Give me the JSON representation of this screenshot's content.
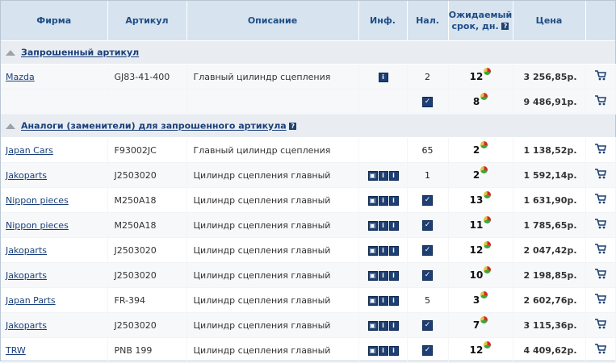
{
  "headers": {
    "firm": "Фирма",
    "article": "Артикул",
    "description": "Описание",
    "info": "Инф.",
    "stock": "Нал.",
    "lead_line1": "Ожидаемый",
    "lead_line2": "срок, дн.",
    "help_glyph": "?",
    "price": "Цена"
  },
  "section_requested": {
    "title": "Запрошенный артикул"
  },
  "section_analogs": {
    "title": "Аналоги (заменители) для запрошенного артикула",
    "help_glyph": "?"
  },
  "requested_rows": [
    {
      "firm": "Mazda",
      "article": "GJ83-41-400",
      "description": "Главный цилиндр сцепления",
      "info_icons": [
        "info-icon"
      ],
      "stock": "2",
      "stock_check": false,
      "lead": "12",
      "price": "3 256,85р."
    },
    {
      "firm": "",
      "article": "",
      "description": "",
      "info_icons": [],
      "stock": "",
      "stock_check": true,
      "lead": "8",
      "price": "9 486,91р."
    }
  ],
  "analog_rows": [
    {
      "firm": "Japan Cars",
      "article": "F93002JC",
      "description": "Главный цилиндр сцепления",
      "info_icons": [],
      "stock": "65",
      "stock_check": false,
      "lead": "2",
      "price": "1 138,52р."
    },
    {
      "firm": "Jakoparts",
      "article": "J2503020",
      "description": "Цилиндр сцепления главный",
      "info_icons": [
        "photo-icon",
        "info-icon",
        "info-icon"
      ],
      "stock": "1",
      "stock_check": false,
      "lead": "2",
      "price": "1 592,14р."
    },
    {
      "firm": "Nippon pieces",
      "article": "M250A18",
      "description": "Цилиндр сцепления главный",
      "info_icons": [
        "photo-icon",
        "info-icon",
        "info-icon"
      ],
      "stock": "",
      "stock_check": true,
      "lead": "13",
      "price": "1 631,90р."
    },
    {
      "firm": "Nippon pieces",
      "article": "M250A18",
      "description": "Цилиндр сцепления главный",
      "info_icons": [
        "photo-icon",
        "info-icon",
        "info-icon"
      ],
      "stock": "",
      "stock_check": true,
      "lead": "11",
      "price": "1 785,65р."
    },
    {
      "firm": "Jakoparts",
      "article": "J2503020",
      "description": "Цилиндр сцепления главный",
      "info_icons": [
        "photo-icon",
        "info-icon",
        "info-icon"
      ],
      "stock": "",
      "stock_check": true,
      "lead": "12",
      "price": "2 047,42р."
    },
    {
      "firm": "Jakoparts",
      "article": "J2503020",
      "description": "Цилиндр сцепления главный",
      "info_icons": [
        "photo-icon",
        "info-icon",
        "info-icon"
      ],
      "stock": "",
      "stock_check": true,
      "lead": "10",
      "price": "2 198,85р."
    },
    {
      "firm": "Japan Parts",
      "article": "FR-394",
      "description": "Цилиндр сцепления главный",
      "info_icons": [
        "photo-icon",
        "info-icon",
        "info-icon"
      ],
      "stock": "5",
      "stock_check": false,
      "lead": "3",
      "price": "2 602,76р."
    },
    {
      "firm": "Jakoparts",
      "article": "J2503020",
      "description": "Цилиндр сцепления главный",
      "info_icons": [
        "photo-icon",
        "info-icon",
        "info-icon"
      ],
      "stock": "",
      "stock_check": true,
      "lead": "7",
      "price": "3 115,36р."
    },
    {
      "firm": "TRW",
      "article": "PNB 199",
      "description": "Цилиндр сцепления главный",
      "info_icons": [
        "photo-icon",
        "info-icon",
        "info-icon"
      ],
      "stock": "",
      "stock_check": true,
      "lead": "12",
      "price": "4 409,62р."
    }
  ],
  "colors": {
    "header_bg": "#d7e3ef",
    "header_text": "#1e4e86",
    "link": "#1a3f7a",
    "icon": "#1d3f73",
    "section_bg": "#e9edf1"
  }
}
